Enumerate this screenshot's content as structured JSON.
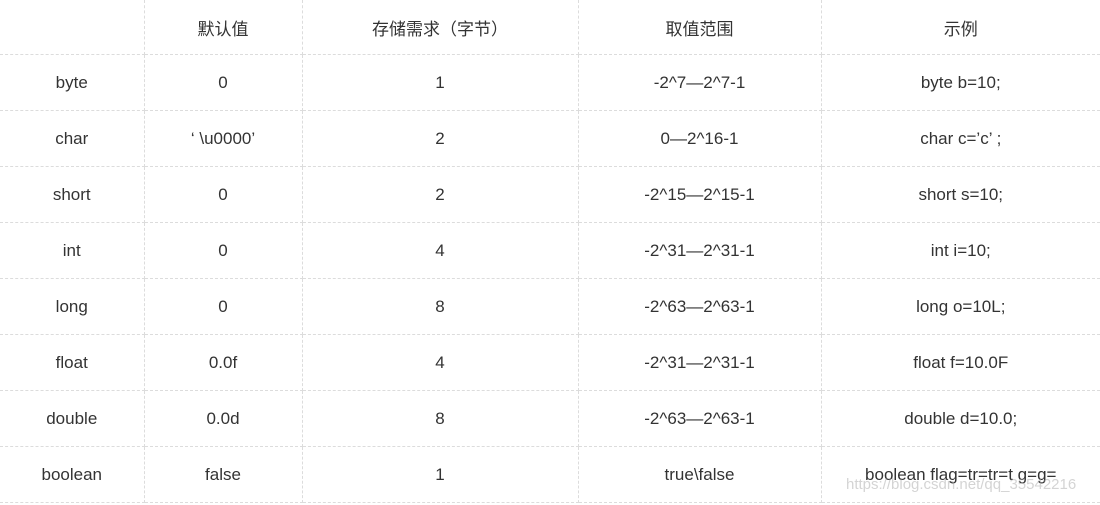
{
  "table": {
    "headers": [
      "",
      "默认值",
      "存储需求（字节）",
      "取值范围",
      "示例"
    ],
    "rows": [
      [
        "byte",
        "0",
        "1",
        "-2^7—2^7-1",
        "byte b=10;"
      ],
      [
        "char",
        "‘ \\u0000’",
        "2",
        "0—2^16-1",
        "char c=’c’ ;"
      ],
      [
        "short",
        "0",
        "2",
        "-2^15—2^15-1",
        "short s=10;"
      ],
      [
        "int",
        "0",
        "4",
        "-2^31—2^31-1",
        "int i=10;"
      ],
      [
        "long",
        "0",
        "8",
        "-2^63—2^63-1",
        "long o=10L;"
      ],
      [
        "float",
        "0.0f",
        "4",
        "-2^31—2^31-1",
        "float f=10.0F"
      ],
      [
        "double",
        "0.0d",
        "8",
        "-2^63—2^63-1",
        "double d=10.0;"
      ],
      [
        "boolean",
        "false",
        "1",
        "true\\false",
        "boolean flag=tr=tr=t      g=g="
      ]
    ]
  },
  "watermark": {
    "text": "https://blog.csdn.net/qq_35542216"
  }
}
